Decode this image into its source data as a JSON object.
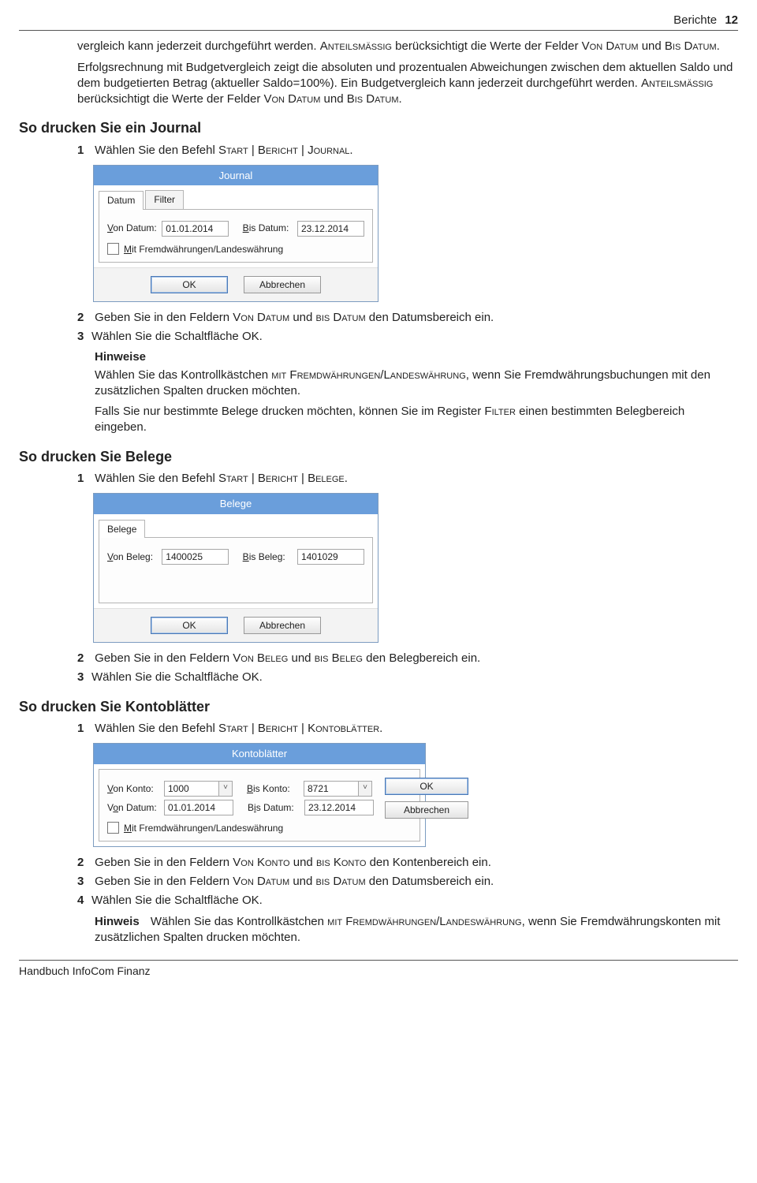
{
  "header": {
    "section": "Berichte",
    "page": "12"
  },
  "intro": {
    "p1a": "vergleich kann jederzeit durchgeführt werden. ",
    "p1b": "Anteilsmässig",
    "p1c": " berücksichtigt die Werte der Felder ",
    "p1d": "Von Datum",
    "p1e": " und ",
    "p1f": "Bis Datum",
    "p1g": ".",
    "p2a": "Erfolgsrechnung mit Budgetvergleich zeigt die absoluten und prozentualen Abweichungen zwischen dem aktuellen Saldo und dem budgetierten Betrag (aktueller Saldo=100%). Ein Budgetvergleich kann jederzeit durchgeführt werden. ",
    "p2b": "Anteilsmässig",
    "p2c": " berücksichtigt die Werte der Felder ",
    "p2d": "Von Datum",
    "p2e": " und ",
    "p2f": "Bis Datum",
    "p2g": "."
  },
  "journal": {
    "heading": "So drucken Sie ein Journal",
    "step1a": "Wählen Sie den Befehl ",
    "step1b": "Start | Bericht | Journal",
    "step1c": ".",
    "dialog": {
      "title": "Journal",
      "tab1": "Datum",
      "tab2": "Filter",
      "von_label": "Von Datum:",
      "von_value": "01.01.2014",
      "bis_label": "Bis Datum:",
      "bis_value": "23.12.2014",
      "chk_label": "Mit Fremdwährungen/Landeswährung",
      "ok": "OK",
      "cancel": "Abbrechen"
    },
    "step2a": "Geben Sie in den Feldern ",
    "step2b": "Von Datum",
    "step2c": " und ",
    "step2d": "bis Datum",
    "step2e": " den Datumsbereich ein.",
    "step3": "Wählen Sie die Schaltfläche OK.",
    "hints_title": "Hinweise",
    "hint1a": "Wählen Sie das Kontrollkästchen ",
    "hint1b": "mit Fremdwährungen/Landeswährung",
    "hint1c": ", wenn Sie Fremdwährungsbuchungen mit den zusätzlichen Spalten drucken möchten.",
    "hint2a": "Falls Sie nur bestimmte Belege drucken möchten, können Sie im Register ",
    "hint2b": "Filter",
    "hint2c": " einen bestimmten Belegbereich eingeben."
  },
  "belege": {
    "heading": "So drucken Sie Belege",
    "step1a": "Wählen Sie den Befehl ",
    "step1b": "Start | Bericht | Belege",
    "step1c": ".",
    "dialog": {
      "title": "Belege",
      "tab1": "Belege",
      "von_label": "Von Beleg:",
      "von_value": "1400025",
      "bis_label": "Bis Beleg:",
      "bis_value": "1401029",
      "ok": "OK",
      "cancel": "Abbrechen"
    },
    "step2a": "Geben Sie in den Feldern ",
    "step2b": "Von Beleg",
    "step2c": " und ",
    "step2d": "bis Beleg",
    "step2e": " den Belegbereich ein.",
    "step3": "Wählen Sie die Schaltfläche OK."
  },
  "konto": {
    "heading": "So drucken Sie Kontoblätter",
    "step1a": "Wählen Sie den Befehl ",
    "step1b": "Start | Bericht | Kontoblätter",
    "step1c": ".",
    "dialog": {
      "title": "Kontoblätter",
      "vk_label": "Von Konto:",
      "vk_value": "1000",
      "bk_label": "Bis Konto:",
      "bk_value": "8721",
      "vd_label": "Von Datum:",
      "vd_value": "01.01.2014",
      "bd_label": "Bis Datum:",
      "bd_value": "23.12.2014",
      "chk_label": "Mit Fremdwährungen/Landeswährung",
      "ok": "OK",
      "cancel": "Abbrechen"
    },
    "step2a": "Geben Sie in den Feldern ",
    "step2b": "Von Konto",
    "step2c": " und ",
    "step2d": "bis Konto",
    "step2e": " den Kontenbereich ein.",
    "step3a": "Geben Sie in den Feldern ",
    "step3b": "Von Datum",
    "step3c": " und ",
    "step3d": "bis Datum",
    "step3e": " den Datumsbereich ein.",
    "step4": "Wählen Sie die Schaltfläche OK.",
    "hint_label": "Hinweis",
    "hint_a": "Wählen Sie das Kontrollkästchen ",
    "hint_b": "mit Fremdwährungen/Landeswährung",
    "hint_c": ", wenn Sie Fremdwährungskonten mit zusätzlichen Spalten drucken möchten."
  },
  "footer": "Handbuch InfoCom Finanz"
}
